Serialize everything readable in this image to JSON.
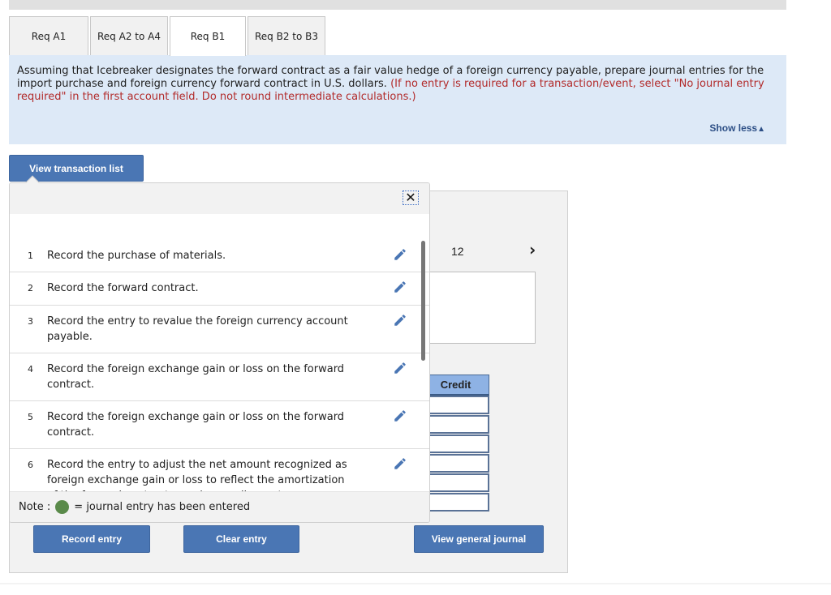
{
  "tabs": [
    {
      "label": "Req A1",
      "active": false
    },
    {
      "label": "Req A2 to A4",
      "active": false
    },
    {
      "label": "Req B1",
      "active": true
    },
    {
      "label": "Req B2 to B3",
      "active": false
    }
  ],
  "instructions": {
    "main": "Assuming that Icebreaker designates the forward contract as a fair value hedge of a foreign currency payable, prepare journal entries for the import purchase and foreign currency forward contract in U.S. dollars.",
    "note": "(If no entry is required for a transaction/event, select \"No journal entry required\" in the first account field. Do not round intermediate calculations.)",
    "show_less": "Show less",
    "show_less_icon": "triangle-up-icon"
  },
  "buttons": {
    "view_transaction_list": "View transaction list",
    "record_entry": "Record entry",
    "clear_entry": "Clear entry",
    "view_general_journal": "View general journal"
  },
  "transactions": [
    {
      "num": "1",
      "text": "Record the purchase of materials."
    },
    {
      "num": "2",
      "text": "Record the forward contract."
    },
    {
      "num": "3",
      "text": "Record the entry to revalue the foreign currency account payable."
    },
    {
      "num": "4",
      "text": "Record the foreign exchange gain or loss on the forward contract."
    },
    {
      "num": "5",
      "text": "Record the foreign exchange gain or loss on the forward contract."
    },
    {
      "num": "6",
      "text": "Record the entry to adjust the net amount recognized as foreign exchange gain or loss to reflect the amortization of the forward contract premium or discount."
    }
  ],
  "note": {
    "prefix": "Note :",
    "suffix": "= journal entry has been entered",
    "dot_color": "#5a8a4a"
  },
  "journal": {
    "page_number": "12",
    "credit_header": "Credit",
    "credit_values": [
      "",
      "",
      "",
      "",
      "",
      ""
    ]
  },
  "colors": {
    "accent": "#4a76b4",
    "instructions_bg": "#dde9f7",
    "instruction_red": "#b22b2b"
  }
}
